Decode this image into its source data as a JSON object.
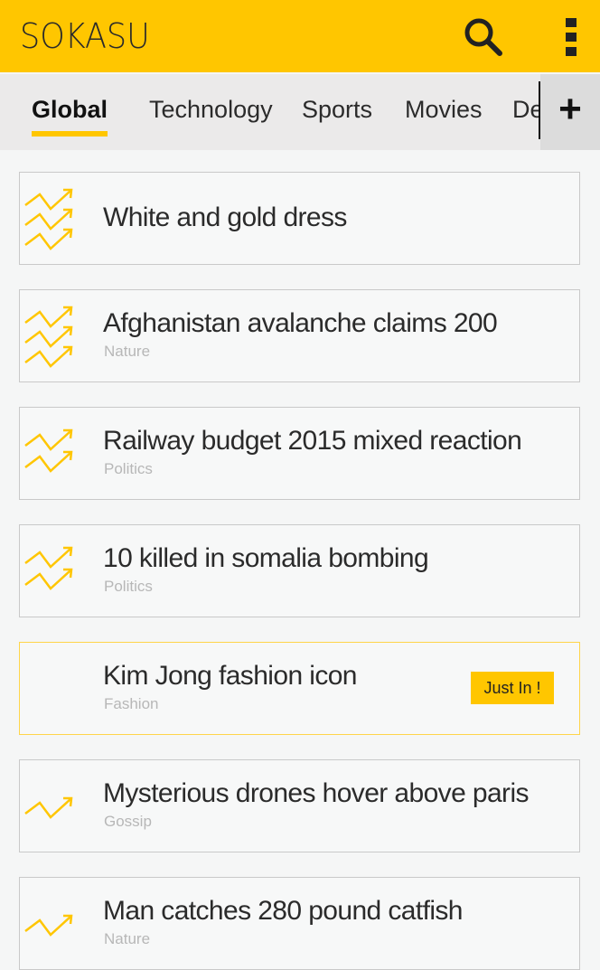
{
  "app": {
    "title": "SOKASU",
    "accent": "#ffc600",
    "icons": {
      "search": "search-icon",
      "menu": "overflow-menu-icon",
      "add": "plus-icon",
      "trend": "trending-up-icon"
    }
  },
  "tabs": [
    {
      "label": "Global",
      "active": true
    },
    {
      "label": "Technology"
    },
    {
      "label": "Sports"
    },
    {
      "label": "Movies"
    },
    {
      "label": "De"
    }
  ],
  "add_label": "+",
  "feed": [
    {
      "title": "White and gold dress",
      "category": "",
      "trend_level": 3
    },
    {
      "title": "Afghanistan avalanche claims 200",
      "category": "Nature",
      "trend_level": 3
    },
    {
      "title": "Railway budget 2015 mixed reaction",
      "category": "Politics",
      "trend_level": 2
    },
    {
      "title": "10 killed in somalia bombing",
      "category": "Politics",
      "trend_level": 2
    },
    {
      "title": "Kim Jong fashion icon",
      "category": "Fashion",
      "trend_level": 0,
      "badge": "Just In !"
    },
    {
      "title": "Mysterious drones hover above paris",
      "category": "Gossip",
      "trend_level": 1
    },
    {
      "title": "Man catches 280 pound catfish",
      "category": "Nature",
      "trend_level": 1
    }
  ]
}
